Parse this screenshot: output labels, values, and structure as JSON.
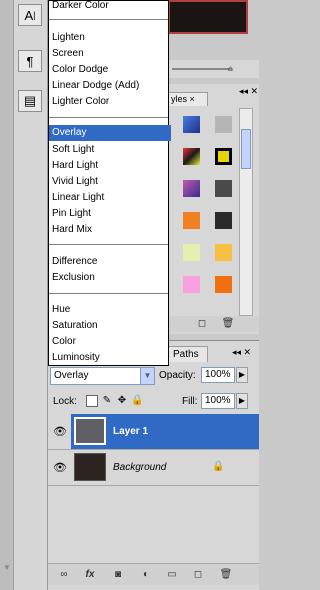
{
  "blend_menu": {
    "items": [
      "Darker Color",
      "Lighten",
      "Screen",
      "Color Dodge",
      "Linear Dodge (Add)",
      "Lighter Color",
      "Overlay",
      "Soft Light",
      "Hard Light",
      "Vivid Light",
      "Linear Light",
      "Pin Light",
      "Hard Mix",
      "Difference",
      "Exclusion",
      "Hue",
      "Saturation",
      "Color",
      "Luminosity"
    ],
    "selected": "Overlay"
  },
  "styles_panel": {
    "tab_label": "yles",
    "close_glyph": "×"
  },
  "layers_panel": {
    "paths_tab_label": "Paths",
    "blend_mode_value": "Overlay",
    "opacity_label": "Opacity:",
    "opacity_value": "100%",
    "lock_label": "Lock:",
    "fill_label": "Fill:",
    "fill_value": "100%",
    "layers": [
      {
        "name": "Layer 1",
        "selected": true
      },
      {
        "name": "Background",
        "selected": false,
        "locked": true
      }
    ]
  },
  "colors": {
    "selection": "#316ac5",
    "layer_selected": "#316ac5"
  }
}
